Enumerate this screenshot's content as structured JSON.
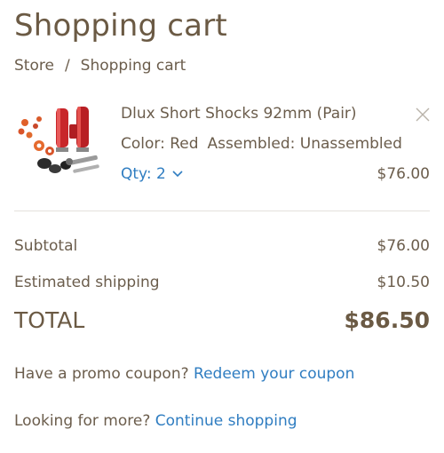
{
  "page": {
    "title": "Shopping cart"
  },
  "breadcrumb": {
    "store": "Store",
    "separator": "/",
    "current": "Shopping cart"
  },
  "cart": {
    "items": [
      {
        "name": "Dlux Short Shocks 92mm (Pair)",
        "variants": [
          "Color: Red",
          "Assembled: Unassembled"
        ],
        "qty_label": "Qty: 2",
        "price": "$76.00",
        "image": "red-shocks-product-photo"
      }
    ]
  },
  "summary": {
    "subtotal_label": "Subtotal",
    "subtotal_value": "$76.00",
    "shipping_label": "Estimated shipping",
    "shipping_value": "$10.50",
    "total_label": "TOTAL",
    "total_value": "$86.50"
  },
  "promo": {
    "text": "Have a promo coupon?",
    "link": "Redeem your coupon"
  },
  "more": {
    "text": "Looking for more?",
    "link": "Continue shopping"
  },
  "icons": {
    "remove": "close-icon",
    "qty": "chevron-down-icon"
  },
  "colors": {
    "link": "#2f7dc1",
    "text": "#6b5d4c",
    "heading": "#6b5a44"
  }
}
